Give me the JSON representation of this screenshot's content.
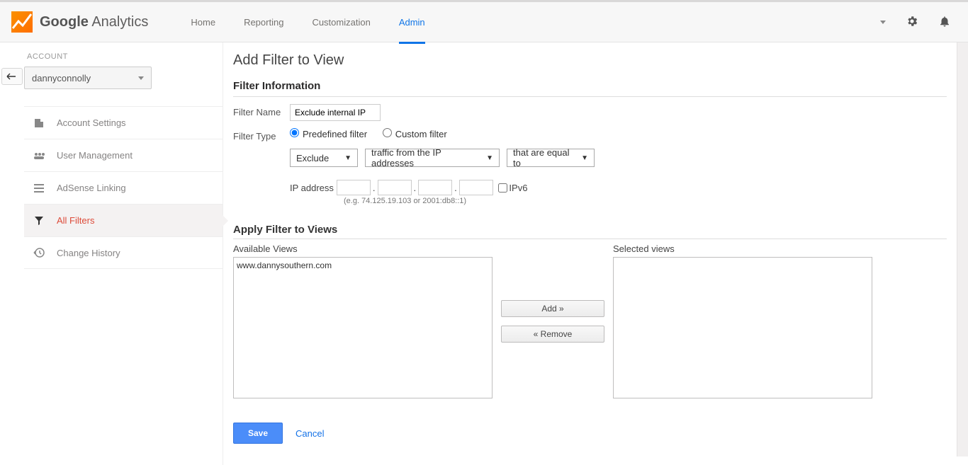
{
  "header": {
    "logo_bold": "Google",
    "logo_light": "Analytics",
    "nav": {
      "home": "Home",
      "reporting": "Reporting",
      "customization": "Customization",
      "admin": "Admin"
    }
  },
  "sidebar": {
    "section_label": "ACCOUNT",
    "account_selected": "dannyconnolly",
    "items": [
      {
        "label": "Account Settings"
      },
      {
        "label": "User Management"
      },
      {
        "label": "AdSense Linking"
      },
      {
        "label": "All Filters"
      },
      {
        "label": "Change History"
      }
    ]
  },
  "main": {
    "title": "Add Filter to View",
    "filterinfo": {
      "heading": "Filter Information",
      "name_label": "Filter Name",
      "name_value": "Exclude internal IP",
      "type_label": "Filter Type",
      "predef": "Predefined filter",
      "custom": "Custom filter",
      "sel1": "Exclude",
      "sel2": "traffic from the IP addresses",
      "sel3": "that are equal to",
      "ip_label": "IP address",
      "ipv6": "IPv6",
      "eg": "(e.g. 74.125.19.103 or 2001:db8::1)"
    },
    "apply": {
      "heading": "Apply Filter to Views",
      "avail_label": "Available Views",
      "sel_label": "Selected views",
      "avail_item": "www.dannysouthern.com",
      "add": "Add »",
      "remove": "« Remove"
    },
    "save": "Save",
    "cancel": "Cancel"
  }
}
